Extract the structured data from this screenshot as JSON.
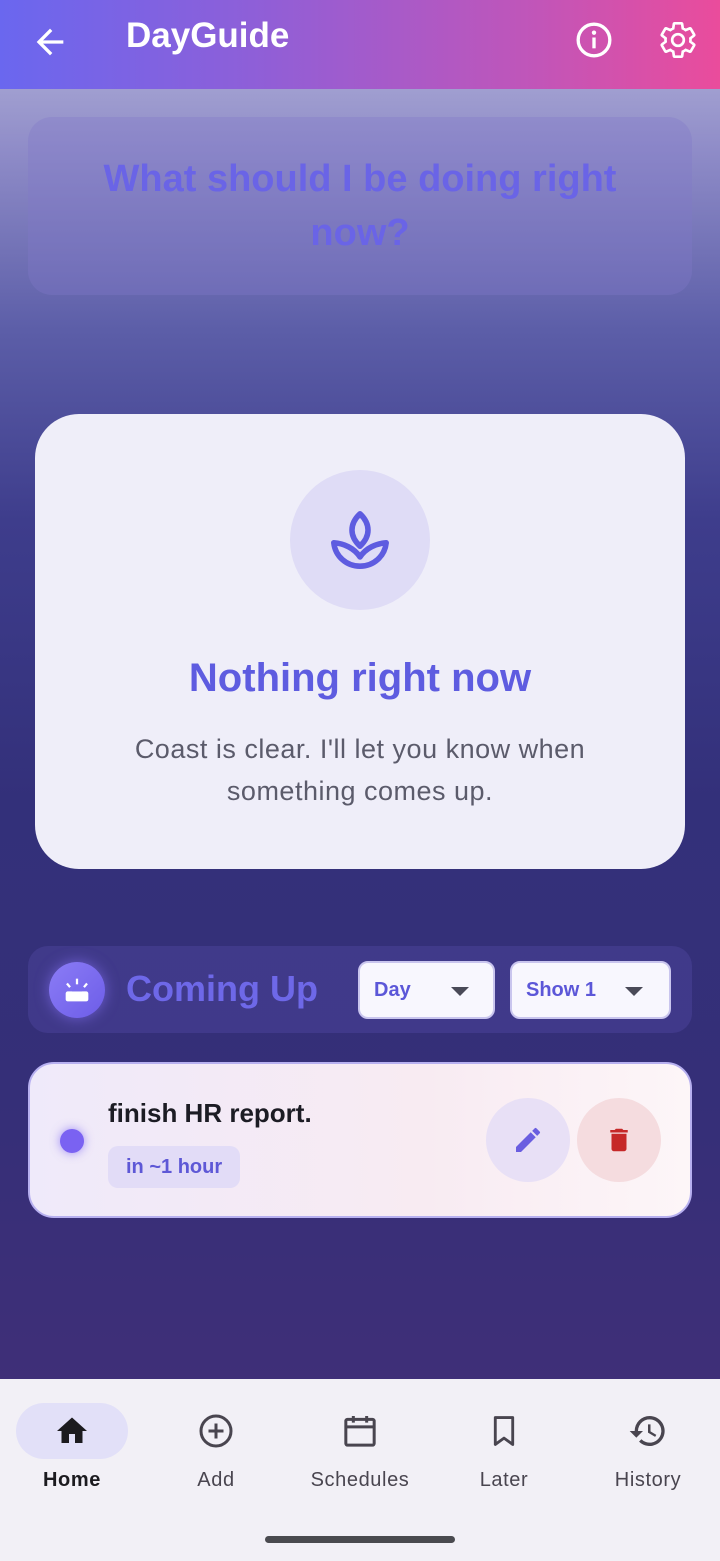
{
  "appbar": {
    "title": "DayGuide",
    "icons": [
      "back-arrow-icon",
      "info-icon",
      "gear-icon"
    ]
  },
  "question": "What should I be doing right now?",
  "now": {
    "icon": "spa-icon",
    "heading": "Nothing right now",
    "message": "Coast is clear. I'll let you know when something comes up."
  },
  "coming_up": {
    "icon": "sunrise-icon",
    "label": "Coming Up",
    "range_select": "Day",
    "count_select": "Show 1"
  },
  "tasks": [
    {
      "name": "finish HR report.",
      "eta": "in ~1 hour",
      "dot_color": "#7a62f2"
    }
  ],
  "nav": {
    "items": [
      {
        "label": "Home",
        "icon": "home-icon",
        "active": true
      },
      {
        "label": "Add",
        "icon": "add-circle-icon",
        "active": false
      },
      {
        "label": "Schedules",
        "icon": "calendar-icon",
        "active": false
      },
      {
        "label": "Later",
        "icon": "bookmark-icon",
        "active": false
      },
      {
        "label": "History",
        "icon": "history-icon",
        "active": false
      }
    ]
  },
  "colors": {
    "accent": "#6a64e6",
    "delete": "#c62828",
    "appbar_start": "#6a67ef",
    "appbar_end": "#ea4c9c"
  }
}
